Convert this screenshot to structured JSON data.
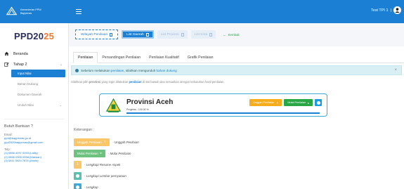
{
  "header": {
    "brand_line1": "Kementerian PPN/",
    "brand_line2": "Bappenas",
    "user_name": "Test TPI 1"
  },
  "sidebar": {
    "app_title_main": "PPD20",
    "app_title_accent": "25",
    "items": [
      {
        "label": "Beranda",
        "icon": "home-icon"
      },
      {
        "label": "Tahap 2",
        "icon": "edit-icon"
      }
    ],
    "sub_items": [
      {
        "label": "Input Nilai",
        "active": true
      },
      {
        "label": "Bahan Dukung"
      },
      {
        "label": "Dokumen Daerah"
      },
      {
        "label": "Unduh Nilai"
      }
    ],
    "help": {
      "title": "Butuh Bantuan ?",
      "email_label": "Email:",
      "emails": [
        "ppd@bappenas.go.id",
        "ppd2025bappenas@gmail.com"
      ],
      "phone_label": "Telp :",
      "phones": [
        "(1) 0856 4097 0093 (Lalily)",
        "(2) 0856 0305 0558 (Marwan)",
        "(3) 0811 5929 7878 (Annie)"
      ]
    }
  },
  "filters": {
    "wilayah": "Wilayah Penilaian",
    "list_daerah": "List Daerah",
    "list_provinsi": "List Provinsi",
    "list_kota": "List Kota",
    "back": "Kembali"
  },
  "tabs": [
    "Penilaian",
    "Persandingan Penilaian",
    "Penilaian Kualitatif",
    "Grafik Penilaian"
  ],
  "alert": {
    "pre": "Sebelum melakukan",
    "hl1": "penilaian",
    "mid": ", silahkan mengunduh",
    "hl2": "bahan dukung"
  },
  "instruction": {
    "pre": "Silahkan pilih",
    "b1": "provinsi",
    "mid": "yang ingin dilakukan",
    "hl": "penilaian",
    "post": "di sisi bawah dan sesuaikan dengan kebutuhan hasil penilaian."
  },
  "province": {
    "name": "Provinsi Aceh",
    "progress_label": "Progress : 100.00 %",
    "progress": 1.0,
    "upload_label": "Unggah Penilaian",
    "start_label": "Mulai Penilaian"
  },
  "legend": {
    "title": "Keterangan :",
    "rows": [
      {
        "button": "Unggah Penilaian",
        "desc": "- Unggah Penilaian"
      },
      {
        "button": "Mulai Penilaian",
        "desc": "- Mulai Penilaian"
      },
      {
        "symbol": "1",
        "desc": "- Lengkapi Resume Aspek"
      },
      {
        "desc": "- Lengkapi Lembar pernyataan"
      },
      {
        "desc": "- Lengkap"
      }
    ]
  },
  "colors": {
    "primary": "#1b7fd4",
    "accent": "#f07a2b",
    "warning": "#f7ac1c",
    "success": "#28a745"
  }
}
